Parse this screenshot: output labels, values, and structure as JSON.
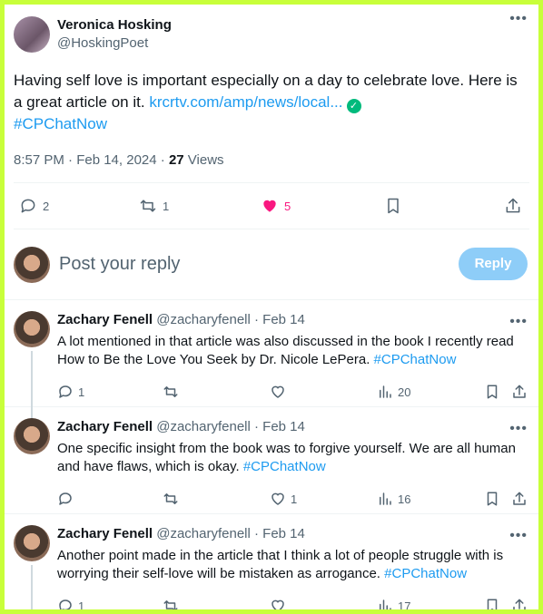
{
  "post": {
    "author_name": "Veronica Hosking",
    "author_handle": "@HoskingPoet",
    "text_before_link": "Having self love is important especially on a day to celebrate love. Here is a great article on it. ",
    "link": "krcrtv.com/amp/news/local...",
    "hashtag": "#CPChatNow",
    "time": "8:57 PM · Feb 14, 2024 · ",
    "views_count": "27",
    "views_label": " Views",
    "replies": "2",
    "reposts": "1",
    "likes": "5",
    "like_color": "#f91880"
  },
  "reply_box": {
    "placeholder": "Post your reply",
    "button": "Reply"
  },
  "comments": [
    {
      "name": "Zachary Fenell",
      "handle": "@zacharyfenell · Feb 14",
      "text": "A lot mentioned in that article was also discussed in the book I recently read How to Be the Love You Seek by Dr. Nicole LePera. ",
      "hashtag": "#CPChatNow",
      "replies": "1",
      "likes": "",
      "views": "20"
    },
    {
      "name": "Zachary Fenell",
      "handle": "@zacharyfenell · Feb 14",
      "text": "One specific insight from the book was to forgive yourself. We are all human and have flaws, which is okay. ",
      "hashtag": "#CPChatNow",
      "replies": "",
      "likes": "1",
      "views": "16"
    },
    {
      "name": "Zachary Fenell",
      "handle": "@zacharyfenell · Feb 14",
      "text": "Another point made in the article that I think a lot of people struggle with is worrying their self-love will be mistaken as arrogance. ",
      "hashtag": "#CPChatNow",
      "replies": "1",
      "likes": "",
      "views": "17"
    }
  ],
  "icons": {
    "more": "more-icon",
    "verified": "verified-check-icon"
  },
  "colors": {
    "accent": "#1d9bf0",
    "frame": "#c8ff3a"
  }
}
